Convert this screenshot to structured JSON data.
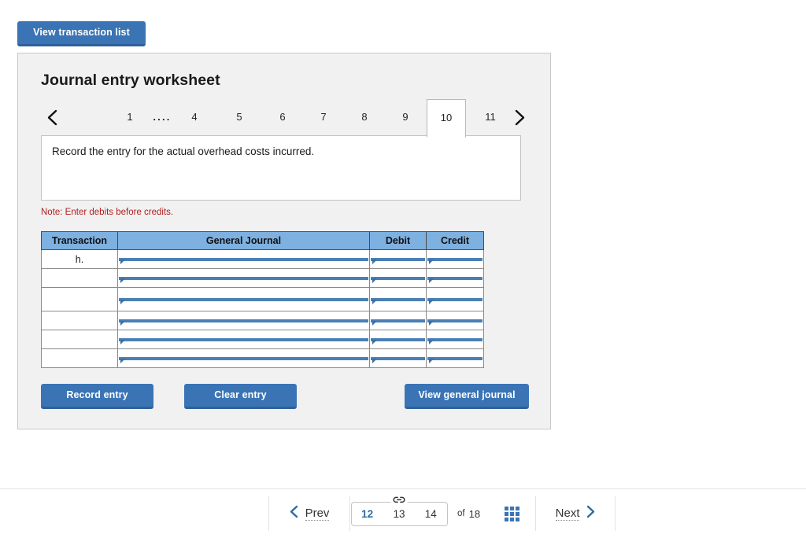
{
  "top": {
    "view_transaction_list": "View transaction list"
  },
  "worksheet": {
    "title": "Journal entry worksheet",
    "instruction": "Record the entry for the actual overhead costs incurred.",
    "note": "Note: Enter debits before credits.",
    "prev_arrow_icon": "chevron-left-icon",
    "next_arrow_icon": "chevron-right-icon",
    "tabs": [
      {
        "label": "1",
        "active": false
      },
      {
        "label": "....",
        "active": false
      },
      {
        "label": "4",
        "active": false
      },
      {
        "label": "5",
        "active": false
      },
      {
        "label": "6",
        "active": false
      },
      {
        "label": "7",
        "active": false
      },
      {
        "label": "8",
        "active": false
      },
      {
        "label": "9",
        "active": false
      },
      {
        "label": "10",
        "active": true
      },
      {
        "label": "11",
        "active": false
      }
    ],
    "table": {
      "headers": [
        "Transaction",
        "General Journal",
        "Debit",
        "Credit"
      ],
      "rows": [
        {
          "transaction": "h.",
          "general_journal": "",
          "debit": "",
          "credit": ""
        },
        {
          "transaction": "",
          "general_journal": "",
          "debit": "",
          "credit": ""
        },
        {
          "transaction": "",
          "general_journal": "",
          "debit": "",
          "credit": ""
        },
        {
          "transaction": "",
          "general_journal": "",
          "debit": "",
          "credit": ""
        },
        {
          "transaction": "",
          "general_journal": "",
          "debit": "",
          "credit": ""
        },
        {
          "transaction": "",
          "general_journal": "",
          "debit": "",
          "credit": ""
        }
      ]
    },
    "actions": {
      "record_entry": "Record entry",
      "clear_entry": "Clear entry",
      "view_general_journal": "View general journal"
    }
  },
  "footer": {
    "prev_label": "Prev",
    "next_label": "Next",
    "prev_icon": "chevron-left-icon",
    "next_icon": "chevron-right-icon",
    "link_icon": "link-chain-icon",
    "grid_icon": "grid-view-icon",
    "pages": [
      {
        "number": "12",
        "current": true
      },
      {
        "number": "13",
        "current": false
      },
      {
        "number": "14",
        "current": false
      }
    ],
    "of_word": "of",
    "total_pages": "18"
  },
  "colors": {
    "primary_blue": "#3a74b5",
    "table_header_blue": "#7eb0e0",
    "input_border_blue": "#4a7fb5",
    "note_red": "#b02020",
    "panel_gray": "#f1f1f1"
  }
}
